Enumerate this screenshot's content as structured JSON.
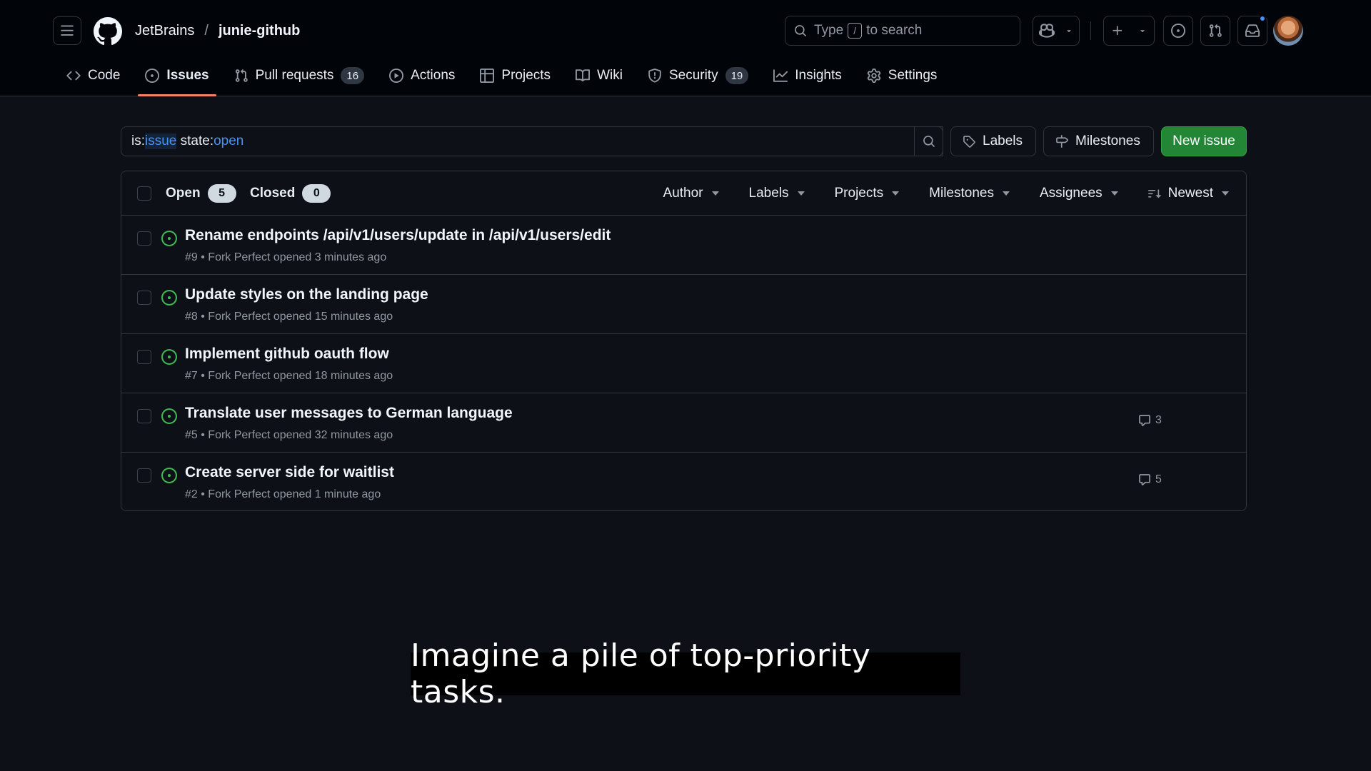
{
  "header": {
    "org": "JetBrains",
    "separator": "/",
    "repo": "junie-github",
    "search": {
      "prefix": "Type",
      "key": "/",
      "suffix": "to search"
    }
  },
  "tabs": [
    {
      "label": "Code",
      "icon": "code-icon"
    },
    {
      "label": "Issues",
      "icon": "issue-opened-icon",
      "active": true
    },
    {
      "label": "Pull requests",
      "icon": "git-pull-request-icon",
      "count": "16"
    },
    {
      "label": "Actions",
      "icon": "play-icon"
    },
    {
      "label": "Projects",
      "icon": "table-icon"
    },
    {
      "label": "Wiki",
      "icon": "book-icon"
    },
    {
      "label": "Security",
      "icon": "shield-icon",
      "count": "19"
    },
    {
      "label": "Insights",
      "icon": "graph-icon"
    },
    {
      "label": "Settings",
      "icon": "gear-icon"
    }
  ],
  "filter": {
    "q1": "is:",
    "q2": "issue",
    "q3": " state:",
    "q4": "open",
    "labels_label": "Labels",
    "milestones_label": "Milestones",
    "new_issue_label": "New issue"
  },
  "list": {
    "open_label": "Open",
    "open_count": "5",
    "closed_label": "Closed",
    "closed_count": "0",
    "filters": [
      "Author",
      "Labels",
      "Projects",
      "Milestones",
      "Assignees"
    ],
    "sort_label": "Newest",
    "issues": [
      {
        "title": "Rename endpoints /api/v1/users/update in /api/v1/users/edit",
        "meta": "#9 • Fork Perfect opened 3 minutes ago",
        "comments": ""
      },
      {
        "title": "Update styles on the landing page",
        "meta": "#8 • Fork Perfect opened 15 minutes ago",
        "comments": ""
      },
      {
        "title": "Implement github oauth flow",
        "meta": "#7 • Fork Perfect opened 18 minutes ago",
        "comments": ""
      },
      {
        "title": "Translate user messages to German language",
        "meta": "#5 • Fork Perfect opened 32 minutes ago",
        "comments": "3"
      },
      {
        "title": "Create server side for waitlist",
        "meta": "#2 • Fork Perfect opened 1 minute ago",
        "comments": "5"
      }
    ]
  },
  "subtitle": "Imagine a pile of top-priority tasks.",
  "colors": {
    "background": "#0d1117",
    "header_bg": "#010409",
    "accent_underline": "#f78166",
    "open_green": "#3fb950",
    "primary_button": "#238636",
    "link_blue": "#4493f8"
  }
}
